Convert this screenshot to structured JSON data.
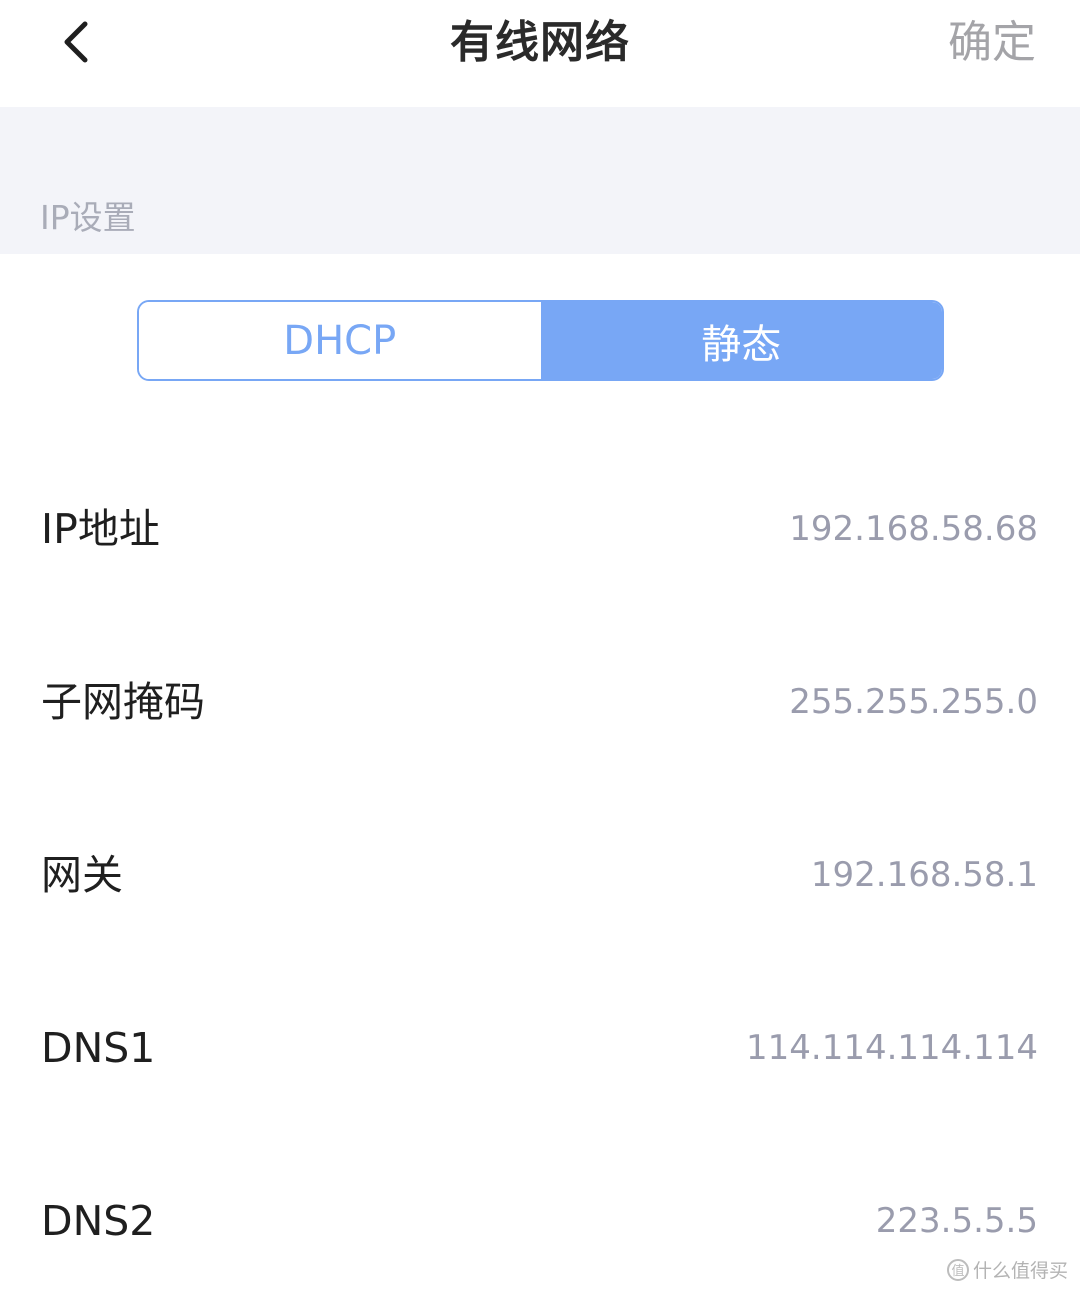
{
  "header": {
    "back_icon": "chevron-left-icon",
    "title": "有线网络",
    "confirm_label": "确定"
  },
  "ip_settings": {
    "section_title": "IP设置",
    "mode_options": [
      "DHCP",
      "静态"
    ],
    "selected_mode": "静态"
  },
  "fields": [
    {
      "label": "IP地址",
      "value": "192.168.58.68"
    },
    {
      "label": "子网掩码",
      "value": "255.255.255.0"
    },
    {
      "label": "网关",
      "value": "192.168.58.1"
    },
    {
      "label": "DNS1",
      "value": "114.114.114.114"
    },
    {
      "label": "DNS2",
      "value": "223.5.5.5"
    }
  ],
  "watermark": {
    "logo_glyph": "值",
    "text": "什么值得买"
  },
  "colors": {
    "accent": "#78a7f5",
    "section_bg": "#f3f4f9",
    "value_text": "#9a9cad",
    "confirm_text": "#a4a4a8"
  }
}
